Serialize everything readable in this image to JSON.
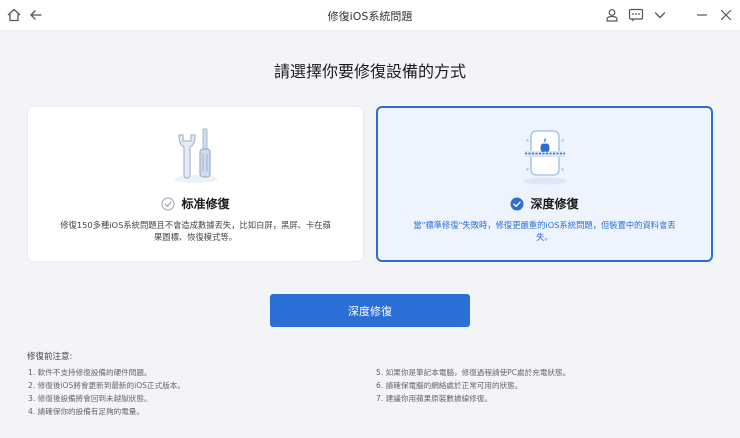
{
  "window": {
    "title": "修復iOS系統問題"
  },
  "heading": "請選擇你要修復設備的方式",
  "modes": {
    "standard": {
      "title": "标准修復",
      "description": "修復150多種iOS系統問題且不會造成數據丟失，比如白屏，黑屏、卡在蘋果圖標、恢復模式等。"
    },
    "deep": {
      "title": "深度修復",
      "description": "當\"標準修復\"失敗時，修復更嚴重的iOS系統問題，但裝置中的資料會丟失。",
      "selected": true
    }
  },
  "primary_button": "深度修復",
  "notes": {
    "title": "修復前注意:",
    "left": [
      "1. 軟件不支持修復設備的硬件問題。",
      "2. 修復後iOS將會更新到最新的iOS正式版本。",
      "3. 修復後設備將會回到未越獄狀態。",
      "4. 請確保你的設備有足夠的電量。"
    ],
    "right": [
      "5. 如果你是筆記本電腦，修復過程請使PC處於充電狀態。",
      "6. 請確保電腦的網絡處於正常可用的狀態。",
      "7. 建議你用蘋果原裝數據線修復。"
    ]
  },
  "colors": {
    "accent": "#2b6fd6",
    "background": "#f2f4f8"
  },
  "icons": [
    "home-icon",
    "back-arrow-icon",
    "user-icon",
    "feedback-icon",
    "dropdown-icon",
    "minimize-icon",
    "close-icon"
  ]
}
